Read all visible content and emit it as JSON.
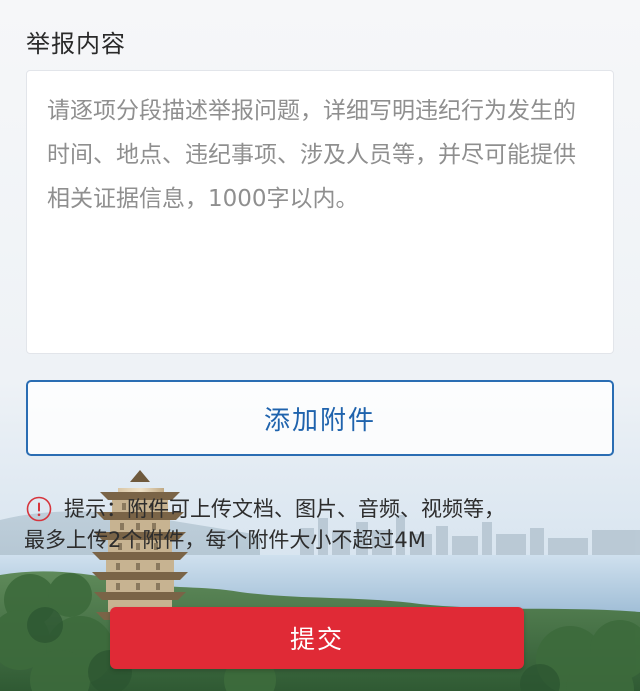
{
  "form": {
    "section_title": "举报内容",
    "content_placeholder": "请逐项分段描述举报问题，详细写明违纪行为发生的时间、地点、违纪事项、涉及人员等，并尽可能提供相关证据信息，1000字以内。",
    "attach_label": "添加附件",
    "hint": {
      "icon": "exclamation-circle-icon",
      "line1": "提示：附件可上传文档、图片、音频、视频等，",
      "line2": "最多上传2个附件，每个附件大小不超过4M"
    },
    "submit_label": "提交"
  },
  "colors": {
    "accent_blue": "#2a6db3",
    "submit_red": "#e02a36",
    "hint_icon_red": "#d6343c",
    "placeholder_gray": "#8f8f8f"
  }
}
